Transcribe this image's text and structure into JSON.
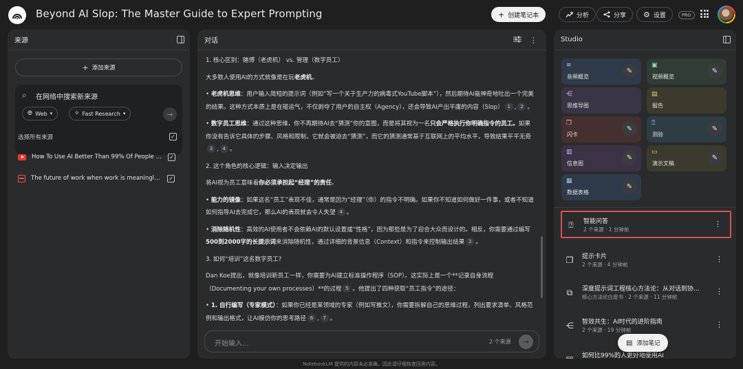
{
  "header": {
    "title": "Beyond AI Slop: The Master Guide to Expert Prompting",
    "create_notebook": "创建笔记本",
    "analytics": "分析",
    "share": "分享",
    "settings": "设置",
    "pro_badge": "PRO"
  },
  "sources": {
    "title": "来源",
    "add_label": "添加来源",
    "search_placeholder": "在网络中搜索新来源",
    "web_chip": "Web",
    "research_chip": "Fast Research",
    "select_all": "选择所有来源",
    "items": [
      {
        "label": "How To Use AI Better Than 99% Of People (...",
        "type": "youtube",
        "checked": true
      },
      {
        "label": "The future of work when work is meaningles...",
        "type": "document",
        "checked": true
      }
    ]
  },
  "chat": {
    "title": "对话",
    "lines": {
      "h1": "1. 核心区别：赌博（老虎机） vs. 管理（数字员工）",
      "p1a": "大多数人使用AI的方式就像是在玩",
      "p1b": "老虎机",
      "p1c": "。",
      "b1_label": "老虎机思维",
      "b1_text": "：用户输入简短的提示词（例如“写一个关于生产力的病毒式YouTube脚本”），然后期待AI能神奇地吐出一个完美的结果。这种方式本质上是在碰运气，不仅剥夺了用户的自主权（Agency），还会导致AI产出平庸的内容（Slop）",
      "b2_label": "数字员工思维",
      "b2_text_a": "：通过这种思维，你不再期待AI去“猜测”你的意图，而是将其视为一名",
      "b2_bold": "只会严格执行你明确指令的员工。",
      "b2_text_b": "如果你没有告诉它具体的步骤、风格和限制，它就会被迫去“猜测”，而它的猜测通常基于互联网上的平均水平，导致结果平平无奇",
      "h2": "2. 这个角色的核心逻辑：输入决定输出",
      "p2a": "将AI视为员工意味着",
      "p2b": "你必须承担起“经理”的责任",
      "p2c": "。",
      "b3_label": "能力的镜像",
      "b3_text": "：如果这名“员工”表现不佳，通常是因为“经理”（你）的指令不明确。如果你不知道如何做好一件事，或者不知道如何指导AI去完成它，那么AI的表现就会令人失望",
      "b4_label": "消除随机性",
      "b4_text_a": "：高效的AI使用者不会依赖AI的默认设置或“性格”，因为那些是为了迎合大众而设计的。相反，你需要通过编写",
      "b4_bold": "500到2000字的长提示词",
      "b4_text_b": "来消除随机性，通过详细的背景信息（Context）和指令来控制输出结果",
      "h3": "3. 如何“培训”这名数字员工?",
      "p3": "Dan Koe提出，就像培训新员工一样，你需要为AI建立标准操作程序（SOP）。这实际上是一个**记录自身流程（Documenting your own processes）**的过程",
      "p3_tail": "。他提出了四种获取“员工指令”的途径：",
      "b5_label": "1. 自行编写（专家模式）",
      "b5_text": "：如果你已经是某领域的专家（例如写推文），你需要拆解自己的思维过程，列出要求清单、风格范例和输出格式，让AI模仿你的思考路径"
    },
    "citations": {
      "c1": "1",
      "c2": "2",
      "c3": "3",
      "c4": "4",
      "c5": "4",
      "c6": "2",
      "c7": "5",
      "c8": "6",
      "c9": "7"
    },
    "input_placeholder": "开始输入...",
    "source_count": "2 个来源"
  },
  "studio": {
    "title": "Studio",
    "tiles": [
      {
        "label": "音频概览",
        "icon": "audio-overview-icon",
        "color": "#2f3a4a"
      },
      {
        "label": "视频概览",
        "icon": "video-overview-icon",
        "color": "#2f3d34"
      },
      {
        "label": "思维导图",
        "icon": "mind-map-icon",
        "color": "#3a3545"
      },
      {
        "label": "报告",
        "icon": "report-icon",
        "color": "#3b3a2c"
      },
      {
        "label": "闪卡",
        "icon": "flashcards-icon",
        "color": "#45302f"
      },
      {
        "label": "测验",
        "icon": "quiz-icon",
        "color": "#2e3c44"
      },
      {
        "label": "信息图",
        "icon": "infographic-icon",
        "color": "#3c3245"
      },
      {
        "label": "演示文稿",
        "icon": "slide-deck-icon",
        "color": "#3b3a2c"
      },
      {
        "label": "数据表格",
        "icon": "data-table-icon",
        "color": "#2f3a4a"
      }
    ],
    "notes": [
      {
        "title": "智能问答",
        "meta": "2 个来源 · 1 分钟前"
      },
      {
        "title": "提示卡片",
        "meta": "2 个来源 · 4 分钟前"
      },
      {
        "title": "深度提示词工程核心方法论：从对话到协...",
        "meta": "核心方法论白皮书 · 2 个来源 · 11 分钟前"
      },
      {
        "title": "智效共生：AI时代的进阶指南",
        "meta": "2 个来源 · 19 分钟前"
      },
      {
        "title": "如何比99%的人更好地使用AI",
        "meta": ""
      }
    ],
    "add_note": "添加笔记"
  },
  "footer": "NotebookLM 提供的内容未必准确，因此请仔细核查回答内容。"
}
